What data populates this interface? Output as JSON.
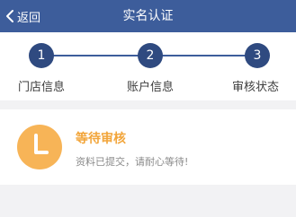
{
  "navbar": {
    "back_label": "返回",
    "title": "实名认证",
    "background": "#3d5d9b"
  },
  "steps": [
    {
      "number": "1",
      "label": "门店信息"
    },
    {
      "number": "2",
      "label": "账户信息"
    },
    {
      "number": "3",
      "label": "审核状态"
    }
  ],
  "status": {
    "icon": "clock-icon",
    "title": "等待审核",
    "description": "资料已提交，请耐心等待!",
    "accent_color": "#f2a53a"
  }
}
